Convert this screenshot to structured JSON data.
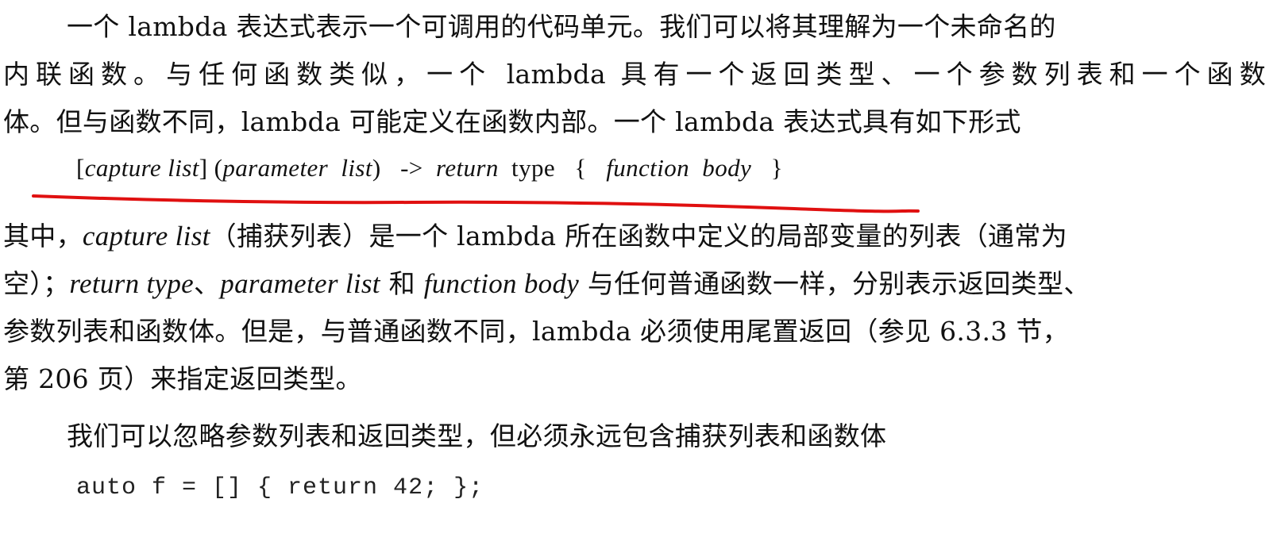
{
  "paragraph1": {
    "line1": "一个 lambda 表达式表示一个可调用的代码单元。我们可以将其理解为一个未命名的",
    "line2": "内联函数。与任何函数类似，一个 lambda 具有一个返回类型、一个参数列表和一个函数",
    "line3": "体。但与函数不同，lambda 可能定义在函数内部。一个 lambda 表达式具有如下形式"
  },
  "syntax": {
    "open_bracket": "[",
    "capture_list": "capture list",
    "close_bracket": "] (",
    "parameter_list": "parameter  list",
    "close_paren": ")   ->  ",
    "return_word": "return",
    "type_word": "  type   {   ",
    "function_body": "function  body",
    "close_brace": "   }"
  },
  "annotation": {
    "underline_color": "#e01010"
  },
  "paragraph2": {
    "l1_a": "其中，",
    "l1_capture": "capture list",
    "l1_b": "（捕获列表）是一个 lambda 所在函数中定义的局部变量的列表（通常为",
    "l2_a": "空）；",
    "l2_return": "return type",
    "l2_b": "、",
    "l2_param": "parameter list",
    "l2_c": " 和 ",
    "l2_body": "function body",
    "l2_d": " 与任何普通函数一样，分别表示返回类型、",
    "line3": "参数列表和函数体。但是，与普通函数不同，lambda 必须使用尾置返回（参见 6.3.3 节，",
    "line4": "第 206 页）来指定返回类型。"
  },
  "paragraph3": {
    "line1": "我们可以忽略参数列表和返回类型，但必须永远包含捕获列表和函数体"
  },
  "code": {
    "line1": "auto f = [] { return 42; };"
  }
}
